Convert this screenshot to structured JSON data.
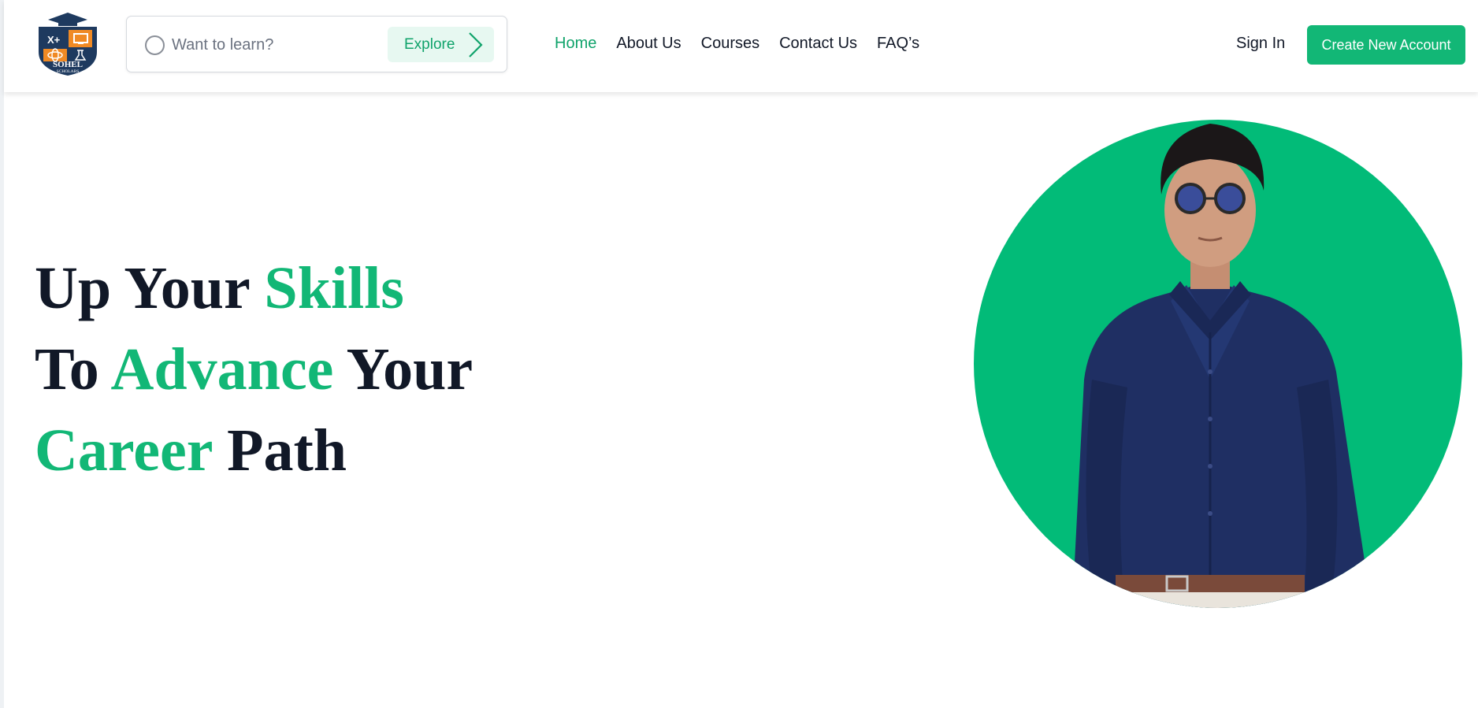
{
  "logo": {
    "line1": "SOHEL",
    "line2": "SCHOLARS",
    "badge_text": "X+",
    "colors": {
      "navy": "#1e3a5f",
      "orange": "#f08a24",
      "white": "#ffffff"
    }
  },
  "search": {
    "placeholder": "Want to learn?",
    "value": "",
    "button_label": "Explore"
  },
  "nav": {
    "items": [
      {
        "label": "Home",
        "active": true
      },
      {
        "label": "About Us",
        "active": false
      },
      {
        "label": "Courses",
        "active": false
      },
      {
        "label": "Contact Us",
        "active": false
      },
      {
        "label": "FAQ’s",
        "active": false
      }
    ]
  },
  "auth": {
    "signin_label": "Sign In",
    "create_label": "Create New Account"
  },
  "hero": {
    "line1": {
      "a": "Up Your ",
      "b": "Skills"
    },
    "line2": {
      "a": "To ",
      "b": "Advance",
      "c": " Your"
    },
    "line3": {
      "a": "Career",
      "b": " Path"
    }
  },
  "colors": {
    "accent": "#12b776",
    "text_dark": "#111827",
    "portrait_bg": "#02bb78"
  }
}
